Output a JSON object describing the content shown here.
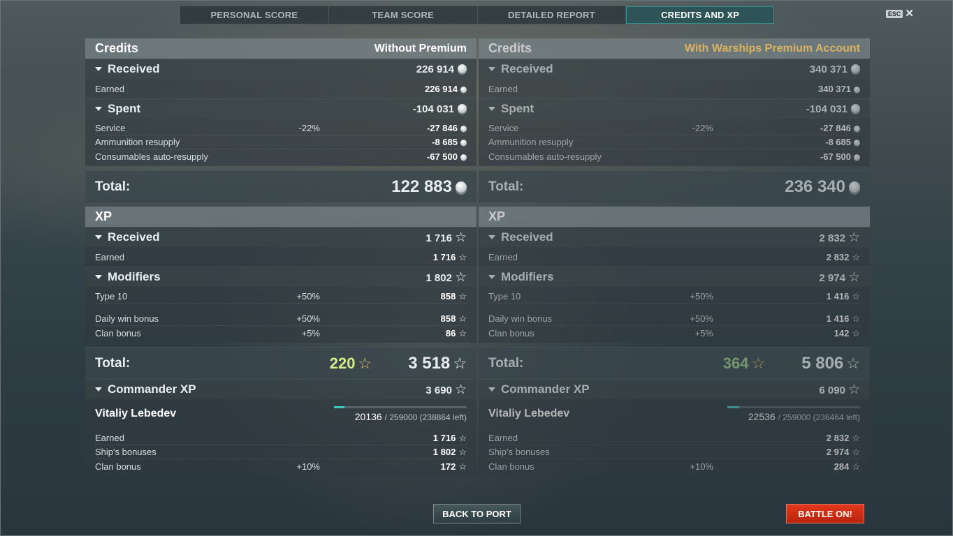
{
  "tabs": [
    "PERSONAL SCORE",
    "TEAM SCORE",
    "DETAILED REPORT",
    "CREDITS AND XP"
  ],
  "esc_label": "ESC",
  "close_glyph": "✕",
  "panels": [
    {
      "credits": {
        "title": "Credits",
        "subtitle": "Without Premium",
        "received": {
          "label": "Received",
          "value": "226 914"
        },
        "earned": {
          "label": "Earned",
          "value": "226 914"
        },
        "spent": {
          "label": "Spent",
          "value": "-104 031"
        },
        "service": {
          "label": "Service",
          "pct": "-22%",
          "value": "-27 846"
        },
        "ammo": {
          "label": "Ammunition resupply",
          "value": "-8 685"
        },
        "consumables": {
          "label": "Consumables auto-resupply",
          "value": "-67 500"
        },
        "total": {
          "label": "Total:",
          "value": "122 883"
        }
      },
      "xp": {
        "title": "XP",
        "received": {
          "label": "Received",
          "value": "1 716"
        },
        "earned": {
          "label": "Earned",
          "value": "1 716"
        },
        "modifiers": {
          "label": "Modifiers",
          "value": "1 802"
        },
        "type10": {
          "label": "Type 10",
          "pct": "+50%",
          "value": "858"
        },
        "daily": {
          "label": "Daily win bonus",
          "pct": "+50%",
          "value": "858"
        },
        "clan": {
          "label": "Clan bonus",
          "pct": "+5%",
          "value": "86"
        },
        "total": {
          "label": "Total:",
          "bonus": "220",
          "value": "3 518"
        }
      },
      "commander": {
        "label": "Commander XP",
        "value": "3 690",
        "name": "Vitaliy Lebedev",
        "progress_current": "20136",
        "progress_rest": "/ 259000 (238864 left)",
        "progress_fraction": 0.078,
        "earned": {
          "label": "Earned",
          "value": "1 716"
        },
        "ship": {
          "label": "Ship's bonuses",
          "value": "1 802"
        },
        "clan": {
          "label": "Clan bonus",
          "pct": "+10%",
          "value": "172"
        }
      }
    },
    {
      "credits": {
        "title": "Credits",
        "subtitle": "With Warships Premium Account",
        "received": {
          "label": "Received",
          "value": "340 371"
        },
        "earned": {
          "label": "Earned",
          "value": "340 371"
        },
        "spent": {
          "label": "Spent",
          "value": "-104 031"
        },
        "service": {
          "label": "Service",
          "pct": "-22%",
          "value": "-27 846"
        },
        "ammo": {
          "label": "Ammunition resupply",
          "value": "-8 685"
        },
        "consumables": {
          "label": "Consumables auto-resupply",
          "value": "-67 500"
        },
        "total": {
          "label": "Total:",
          "value": "236 340"
        }
      },
      "xp": {
        "title": "XP",
        "received": {
          "label": "Received",
          "value": "2 832"
        },
        "earned": {
          "label": "Earned",
          "value": "2 832"
        },
        "modifiers": {
          "label": "Modifiers",
          "value": "2 974"
        },
        "type10": {
          "label": "Type 10",
          "pct": "+50%",
          "value": "1 416"
        },
        "daily": {
          "label": "Daily win bonus",
          "pct": "+50%",
          "value": "1 416"
        },
        "clan": {
          "label": "Clan bonus",
          "pct": "+5%",
          "value": "142"
        },
        "total": {
          "label": "Total:",
          "bonus": "364",
          "value": "5 806"
        }
      },
      "commander": {
        "label": "Commander XP",
        "value": "6 090",
        "name": "Vitaliy Lebedev",
        "progress_current": "22536",
        "progress_rest": "/ 259000 (236464 left)",
        "progress_fraction": 0.087,
        "earned": {
          "label": "Earned",
          "value": "2 832"
        },
        "ship": {
          "label": "Ship's bonuses",
          "value": "2 974"
        },
        "clan": {
          "label": "Clan bonus",
          "pct": "+10%",
          "value": "284"
        }
      }
    }
  ],
  "buttons": {
    "back_to_port": "BACK TO PORT",
    "battle": "BATTLE ON!"
  },
  "colors": {
    "accent_teal": "#43c6c0",
    "premium_gold": "#d9b160",
    "battle_red": "#e2381c",
    "xp_bonus": "#d4ec86"
  },
  "icons": {
    "credits": "silver-coin-icon",
    "xp": "star-icon",
    "collapse": "triangle-down-icon"
  }
}
